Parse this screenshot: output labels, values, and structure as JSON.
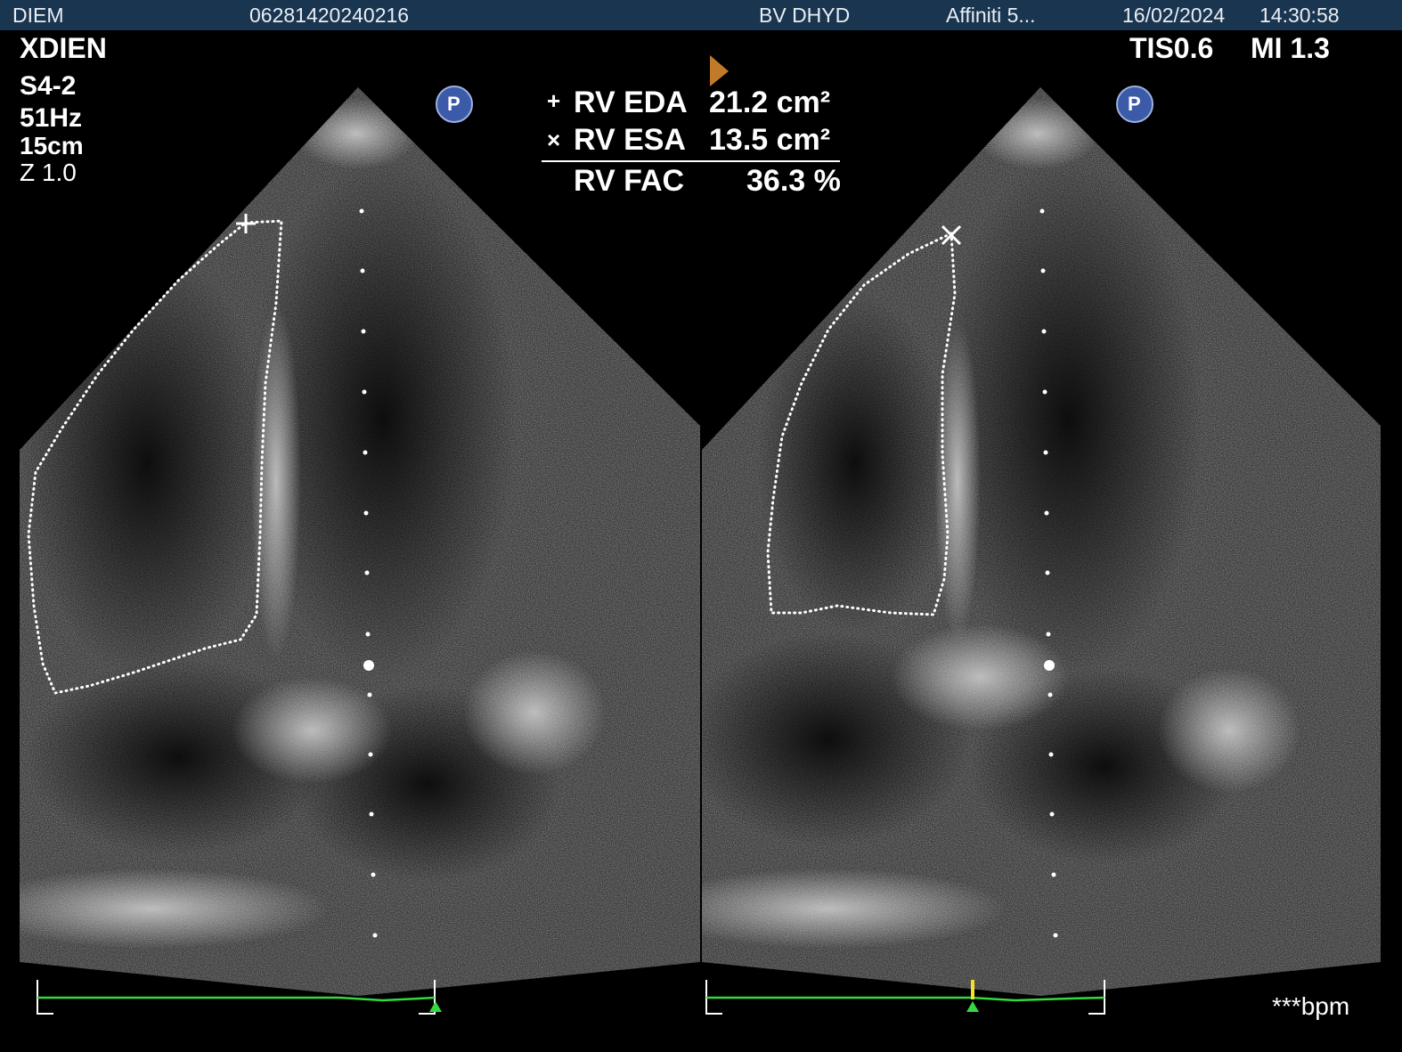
{
  "header": {
    "facility": "DIEM",
    "patient_id": "06281420240216",
    "hospital": "BV DHYD",
    "device": "Affiniti 5...",
    "date": "16/02/2024",
    "time": "14:30:58"
  },
  "patient_name": "XDIEN",
  "probe": "S4-2",
  "frame_rate": "51Hz",
  "depth": "15cm",
  "zoom": "Z 1.0",
  "safety": {
    "tis": "TIS0.6",
    "mi": "MI 1.3"
  },
  "measurements": {
    "rv_eda_label": "RV EDA",
    "rv_eda_value": "21.2 cm²",
    "rv_esa_label": "RV ESA",
    "rv_esa_value": "13.5 cm²",
    "rv_fac_label": "RV FAC",
    "rv_fac_value": "36.3 %",
    "plus_marker": "+",
    "cross_marker": "×"
  },
  "heart_rate": "***bpm",
  "p_badge": "P",
  "colors": {
    "header_bg": "#1a3550",
    "ecg_green": "#35d840",
    "orientation_marker": "#c07a2a",
    "p_badge": "#3b5aa8"
  },
  "icons": [
    "orientation-marker-icon",
    "p-badge-icon",
    "ecg-trigger-icon"
  ]
}
